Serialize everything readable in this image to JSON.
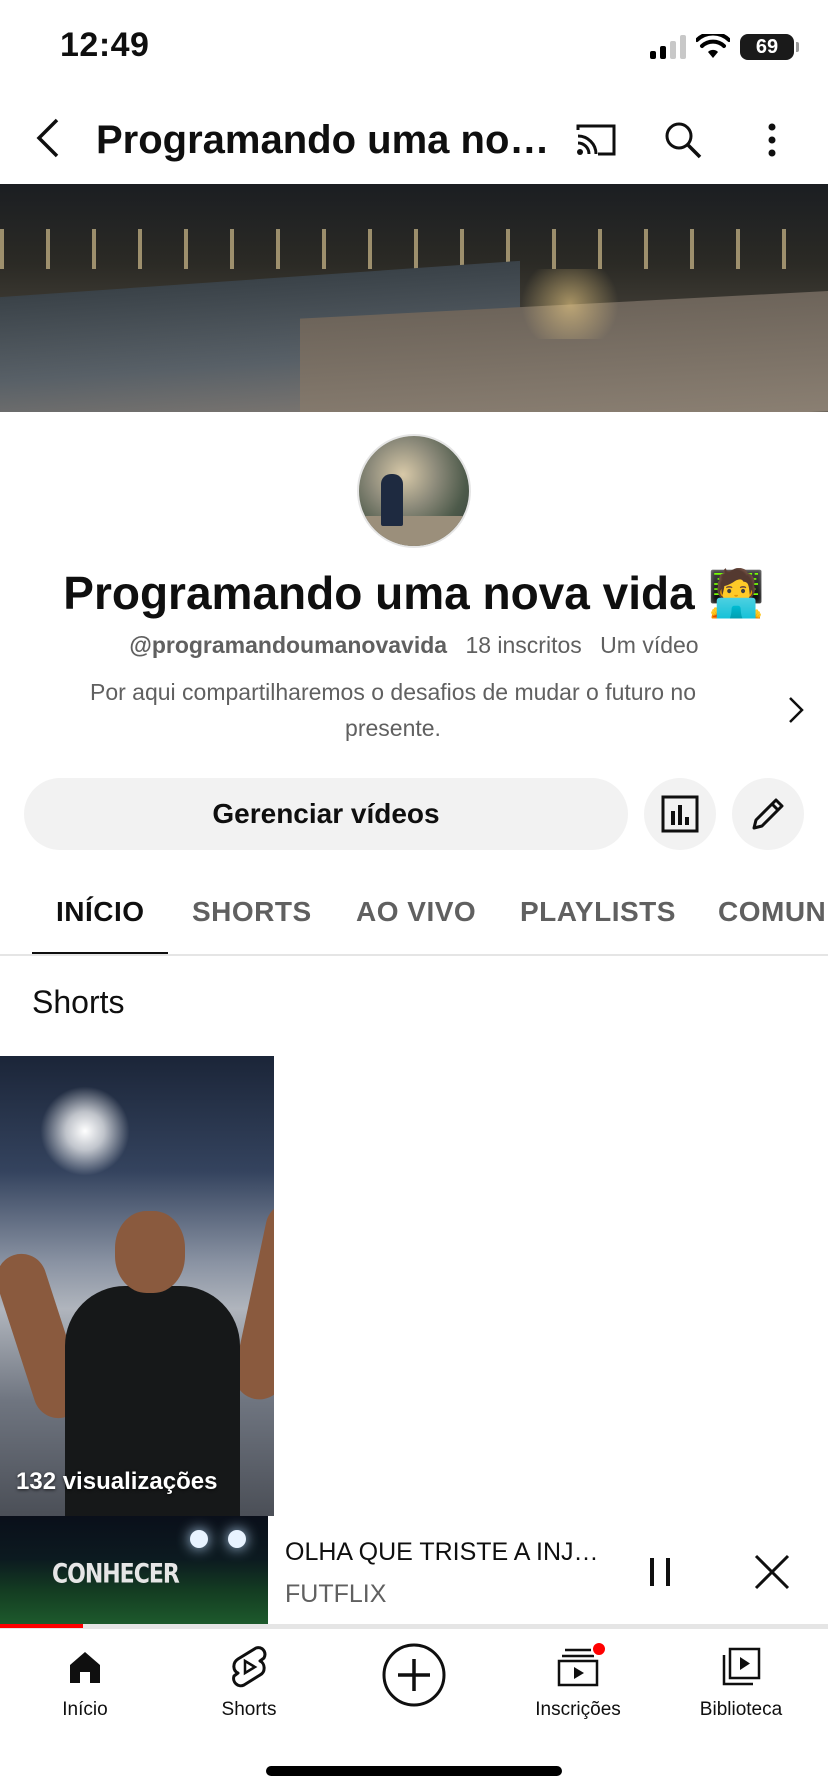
{
  "status_bar": {
    "time": "12:49",
    "battery": "69"
  },
  "app_bar": {
    "title": "Programando uma nova vida 🧑‍💻"
  },
  "channel": {
    "name": "Programando uma nova vida 🧑‍💻",
    "handle": "@programandoumanovavida",
    "subscribers": "18 inscritos",
    "video_count": "Um vídeo",
    "description": "Por aqui compartilharemos o desafios de mudar o futuro no presente."
  },
  "actions": {
    "manage_videos": "Gerenciar vídeos"
  },
  "tabs": [
    {
      "label": "INÍCIO",
      "active": true
    },
    {
      "label": "SHORTS"
    },
    {
      "label": "AO VIVO"
    },
    {
      "label": "PLAYLISTS"
    },
    {
      "label": "COMUNIDADE"
    }
  ],
  "shorts_section": {
    "title": "Shorts",
    "items": [
      {
        "views": "132 visualizações"
      }
    ]
  },
  "mini_player": {
    "thumbnail_text": "CONHECER",
    "title": "OLHA QUE TRISTE A INJUSTIÇA",
    "channel": "FUTFLIX",
    "progress": 0.1
  },
  "bottom_nav": [
    {
      "label": "Início",
      "icon": "home-icon"
    },
    {
      "label": "Shorts",
      "icon": "shorts-icon"
    },
    {
      "label": "",
      "icon": "create-icon"
    },
    {
      "label": "Inscrições",
      "icon": "subscriptions-icon"
    },
    {
      "label": "Biblioteca",
      "icon": "library-icon"
    }
  ],
  "colors": {
    "accent": "#ff0000",
    "text_primary": "#0f0f0f",
    "text_secondary": "#606060",
    "chip_bg": "#f2f2f2"
  }
}
